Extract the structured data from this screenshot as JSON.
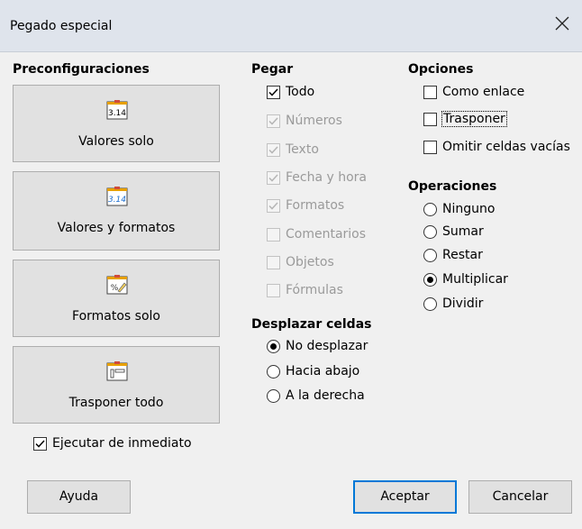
{
  "dialog": {
    "title": "Pegado especial"
  },
  "presets": {
    "header": "Preconfiguraciones",
    "buttons": [
      {
        "label": "Valores solo",
        "icon": "values-only-icon"
      },
      {
        "label": "Valores y formatos",
        "icon": "values-formats-icon"
      },
      {
        "label": "Formatos solo",
        "icon": "formats-only-icon"
      },
      {
        "label": "Trasponer todo",
        "icon": "transpose-all-icon"
      }
    ],
    "run_immediately": {
      "label": "Ejecutar de inmediato",
      "checked": true
    }
  },
  "paste": {
    "header": "Pegar",
    "items": [
      {
        "label": "Todo",
        "checked": true,
        "enabled": true
      },
      {
        "label": "Números",
        "checked": true,
        "enabled": false
      },
      {
        "label": "Texto",
        "checked": true,
        "enabled": false
      },
      {
        "label": "Fecha y hora",
        "checked": true,
        "enabled": false
      },
      {
        "label": "Formatos",
        "checked": true,
        "enabled": false
      },
      {
        "label": "Comentarios",
        "checked": false,
        "enabled": false
      },
      {
        "label": "Objetos",
        "checked": false,
        "enabled": false
      },
      {
        "label": "Fórmulas",
        "checked": false,
        "enabled": false
      }
    ]
  },
  "shift": {
    "header": "Desplazar celdas",
    "items": [
      {
        "label": "No desplazar",
        "selected": true
      },
      {
        "label": "Hacia abajo",
        "selected": false
      },
      {
        "label": "A la derecha",
        "selected": false
      }
    ]
  },
  "options": {
    "header": "Opciones",
    "items": [
      {
        "label": "Como enlace",
        "checked": false
      },
      {
        "label": "Trasponer",
        "checked": false
      },
      {
        "label": "Omitir celdas vacías",
        "checked": false
      }
    ]
  },
  "operations": {
    "header": "Operaciones",
    "items": [
      {
        "label": "Ninguno",
        "selected": false
      },
      {
        "label": "Sumar",
        "selected": false
      },
      {
        "label": "Restar",
        "selected": false
      },
      {
        "label": "Multiplicar",
        "selected": true
      },
      {
        "label": "Dividir",
        "selected": false
      }
    ]
  },
  "footer": {
    "help": "Ayuda",
    "ok": "Aceptar",
    "cancel": "Cancelar"
  },
  "colors": {
    "accent": "#0078d7",
    "titlebar": "#dfe4ec",
    "disabled_text": "#9a9a9a"
  }
}
